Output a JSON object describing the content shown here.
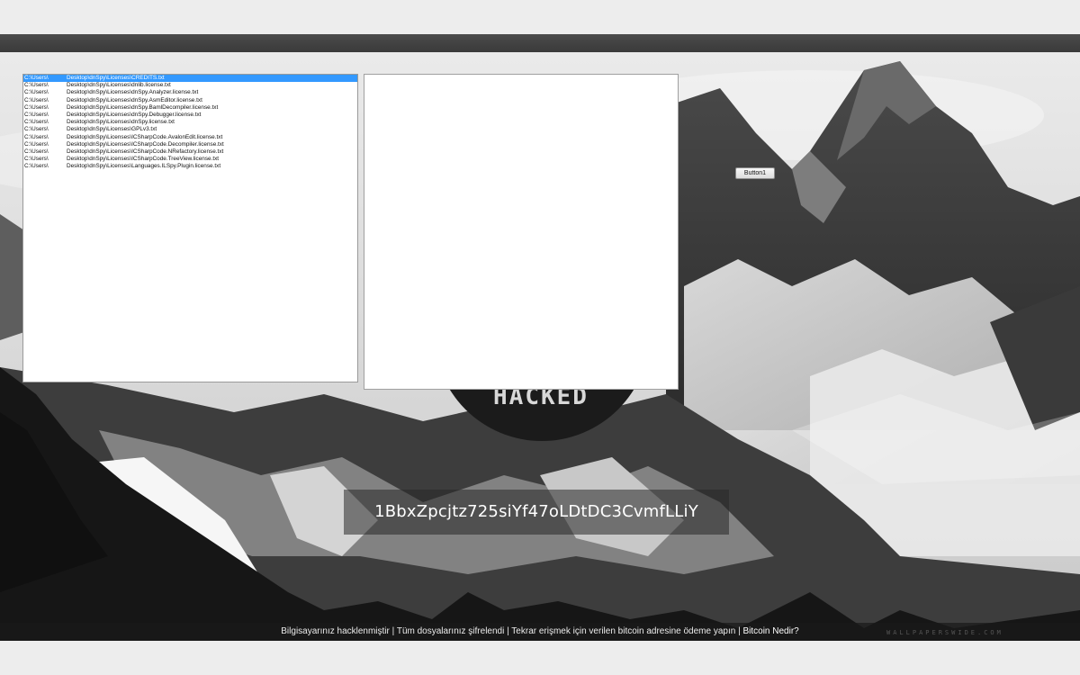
{
  "listbox": {
    "items": [
      {
        "path_prefix": "C:\\Users\\",
        "path_rest": "Desktop\\dnSpy\\Licenses\\CREDITS.txt",
        "selected": true
      },
      {
        "path_prefix": "C:\\Users\\",
        "path_rest": "Desktop\\dnSpy\\Licenses\\dnlib.license.txt",
        "selected": false
      },
      {
        "path_prefix": "C:\\Users\\",
        "path_rest": "Desktop\\dnSpy\\Licenses\\dnSpy.Analyzer.license.txt",
        "selected": false
      },
      {
        "path_prefix": "C:\\Users\\",
        "path_rest": "Desktop\\dnSpy\\Licenses\\dnSpy.AsmEditor.license.txt",
        "selected": false
      },
      {
        "path_prefix": "C:\\Users\\",
        "path_rest": "Desktop\\dnSpy\\Licenses\\dnSpy.BamlDecompiler.license.txt",
        "selected": false
      },
      {
        "path_prefix": "C:\\Users\\",
        "path_rest": "Desktop\\dnSpy\\Licenses\\dnSpy.Debugger.license.txt",
        "selected": false
      },
      {
        "path_prefix": "C:\\Users\\",
        "path_rest": "Desktop\\dnSpy\\Licenses\\dnSpy.license.txt",
        "selected": false
      },
      {
        "path_prefix": "C:\\Users\\",
        "path_rest": "Desktop\\dnSpy\\Licenses\\GPLv3.txt",
        "selected": false
      },
      {
        "path_prefix": "C:\\Users\\",
        "path_rest": "Desktop\\dnSpy\\Licenses\\ICSharpCode.AvalonEdit.license.txt",
        "selected": false
      },
      {
        "path_prefix": "C:\\Users\\",
        "path_rest": "Desktop\\dnSpy\\Licenses\\ICSharpCode.Decompiler.license.txt",
        "selected": false
      },
      {
        "path_prefix": "C:\\Users\\",
        "path_rest": "Desktop\\dnSpy\\Licenses\\ICSharpCode.NRefactory.license.txt",
        "selected": false
      },
      {
        "path_prefix": "C:\\Users\\",
        "path_rest": "Desktop\\dnSpy\\Licenses\\ICSharpCode.TreeView.license.txt",
        "selected": false
      },
      {
        "path_prefix": "C:\\Users\\",
        "path_rest": "Desktop\\dnSpy\\Licenses\\Languages.ILSpy.Plugin.license.txt",
        "selected": false
      }
    ]
  },
  "button1": {
    "label": "Button1"
  },
  "hacked_logo": {
    "text": "HACKED"
  },
  "bitcoin_address": "1BbxZpcjtz725siYf47oLDtDC3CvmfLLiY",
  "status_bar": {
    "message": "Bilgisayarınız hacklenmiştir | Tüm dosyalarınız şifrelendi | Tekrar erişmek için verilen bitcoin adresine ödeme yapın |",
    "link_label": "Bitcoin Nedir?"
  },
  "watermark": {
    "text": "WALLPAPERSWIDE.COM"
  },
  "colors": {
    "selection": "#3399ff",
    "status_bar_bg": "#191919",
    "address_band_bg": "#282828"
  }
}
